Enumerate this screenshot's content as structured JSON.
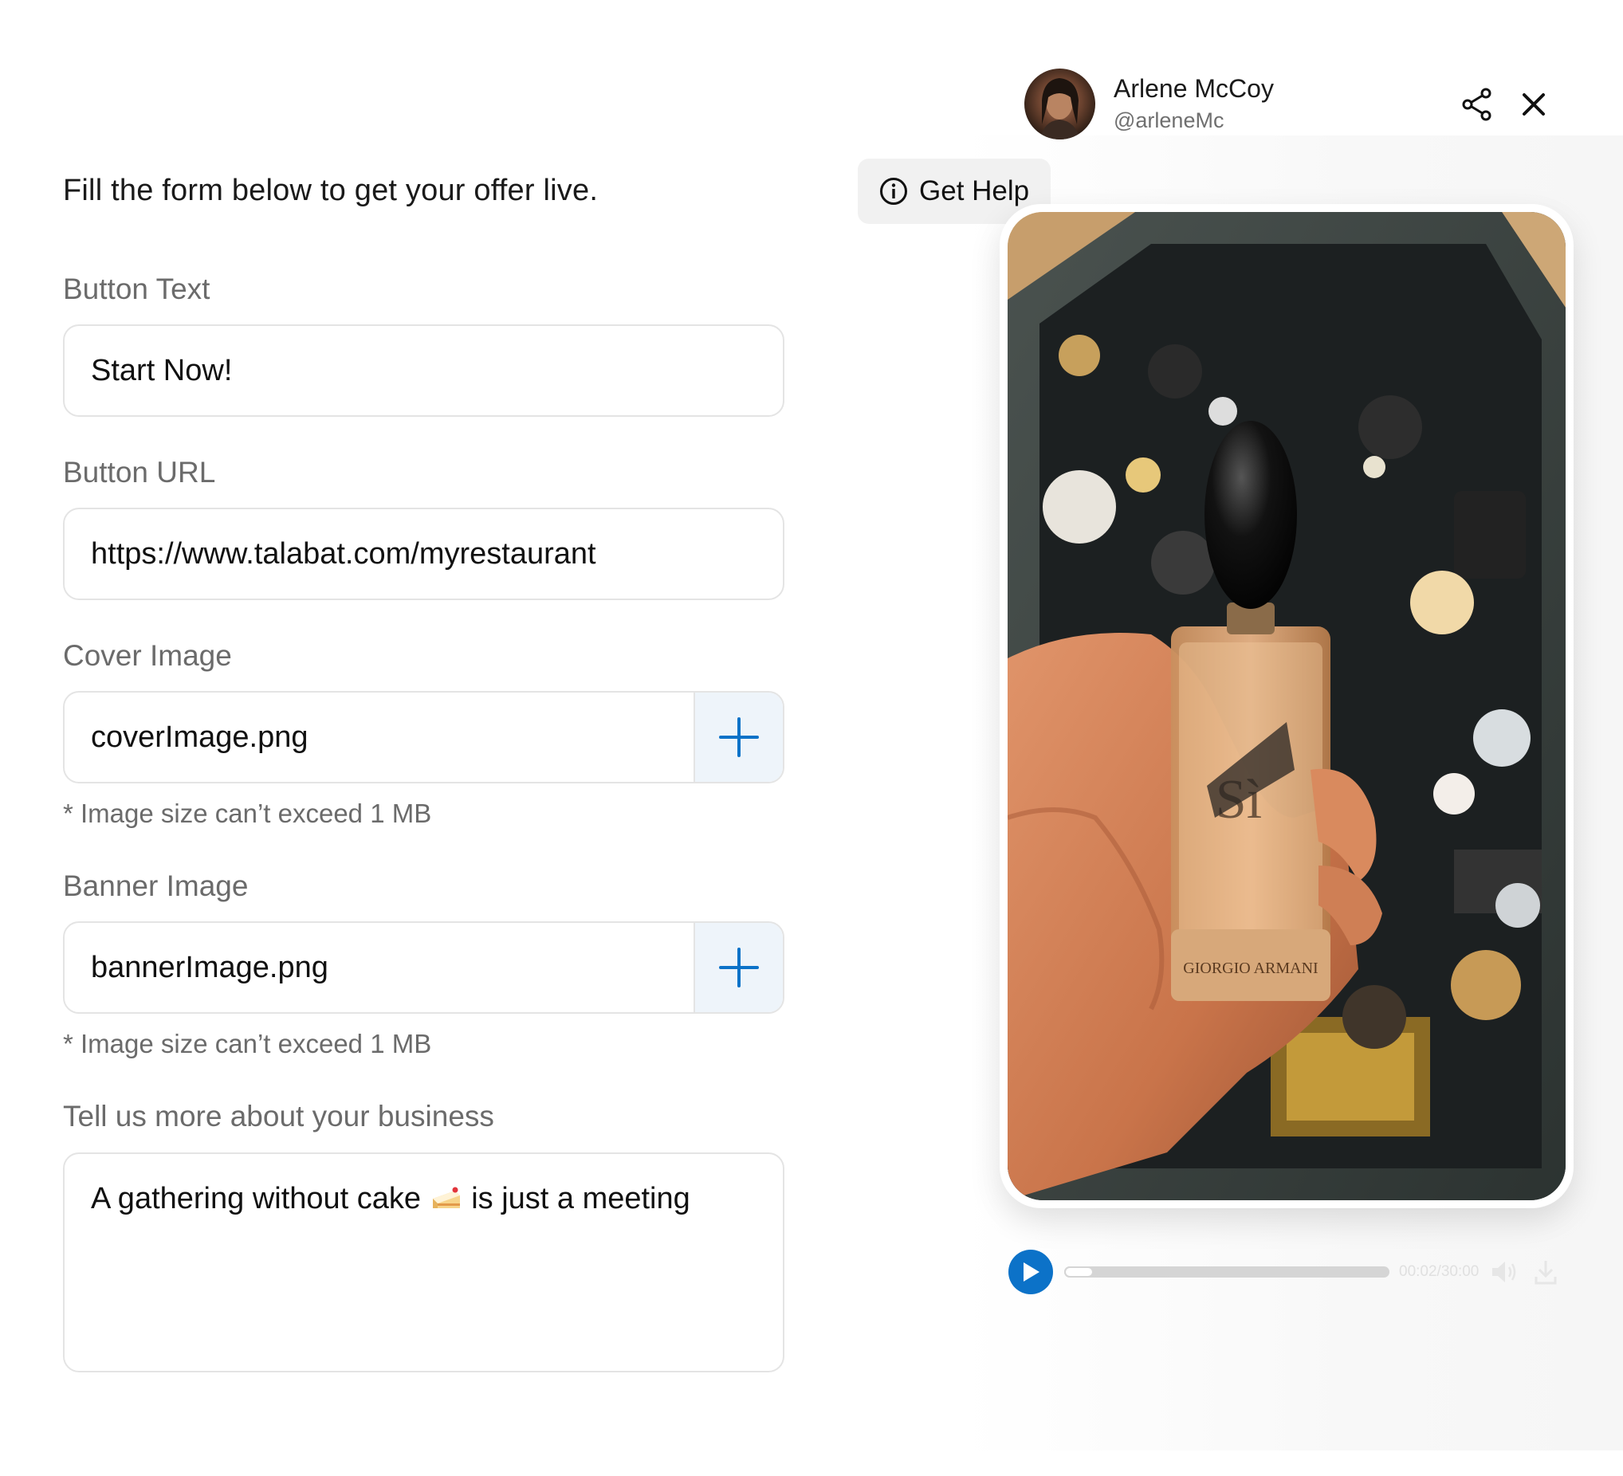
{
  "form": {
    "intro": "Fill the form below to get your offer live.",
    "button_text": {
      "label": "Button Text",
      "value": "Start Now!"
    },
    "button_url": {
      "label": "Button URL",
      "value": "https://www.talabat.com/myrestaurant"
    },
    "cover_image": {
      "label": "Cover Image",
      "value": "coverImage.png",
      "hint": "* Image size can’t exceed 1 MB"
    },
    "banner_image": {
      "label": "Banner Image",
      "value": "bannerImage.png",
      "hint": "* Image size can’t exceed 1 MB"
    },
    "business": {
      "label": "Tell us more about your business",
      "value_before": "A gathering without cake",
      "value_after": "is just a meeting"
    }
  },
  "preview": {
    "help_label": "Get Help",
    "user": {
      "name": "Arlene McCoy",
      "handle": "@arleneMc"
    },
    "player": {
      "time": "00:02/30:00",
      "progress": 0.067
    }
  },
  "colors": {
    "accent": "#0c72c8",
    "add_button_bg": "#eef4fa",
    "label": "#6b6b6b"
  },
  "icons": [
    "plus-icon",
    "info-icon",
    "share-icon",
    "close-icon",
    "play-icon",
    "volume-icon",
    "download-icon",
    "cake-emoji"
  ]
}
